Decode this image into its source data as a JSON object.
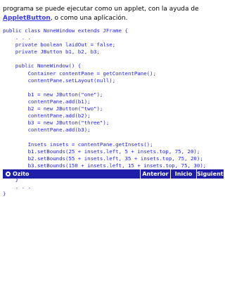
{
  "intro": {
    "before_link": "programa se puede ejecutar como un applet, con la ayuda de ",
    "link": "AppletButton",
    "after_link": ", o como una aplicación."
  },
  "code": {
    "lines": [
      "public class NoneWindow extends JFrame {",
      "    . . .",
      "    private boolean laidOut = false;",
      "    private JButton b1, b2, b3;",
      "",
      "    public NoneWindow() {",
      "        Container contentPane = getContentPane();",
      "        contentPane.setLayout(null);",
      "",
      "        b1 = new JButton(\"one\");",
      "        contentPane.add(b1);",
      "        b2 = new JButton(\"two\");",
      "        contentPane.add(b2);",
      "        b3 = new JButton(\"three\");",
      "        contentPane.add(b3);",
      "",
      "        Insets insets = contentPane.getInsets();",
      "        b1.setBounds(25 + insets.left, 5 + insets.top, 75, 20);",
      "        b2.setBounds(55 + insets.left, 35 + insets.top, 75, 20);",
      "        b3.setBounds(150 + insets.left, 15 + insets.top, 75, 30);",
      "        . . .",
      "    }",
      "    . . .",
      "}"
    ]
  },
  "nav": {
    "home_label": "Ozito",
    "prev_label": "Anterior",
    "index_label": "Inicio",
    "next_label": "Siguiente"
  },
  "colors": {
    "link": "#3a3af0",
    "code": "#2222ee",
    "navbar": "#1e1ea8"
  }
}
